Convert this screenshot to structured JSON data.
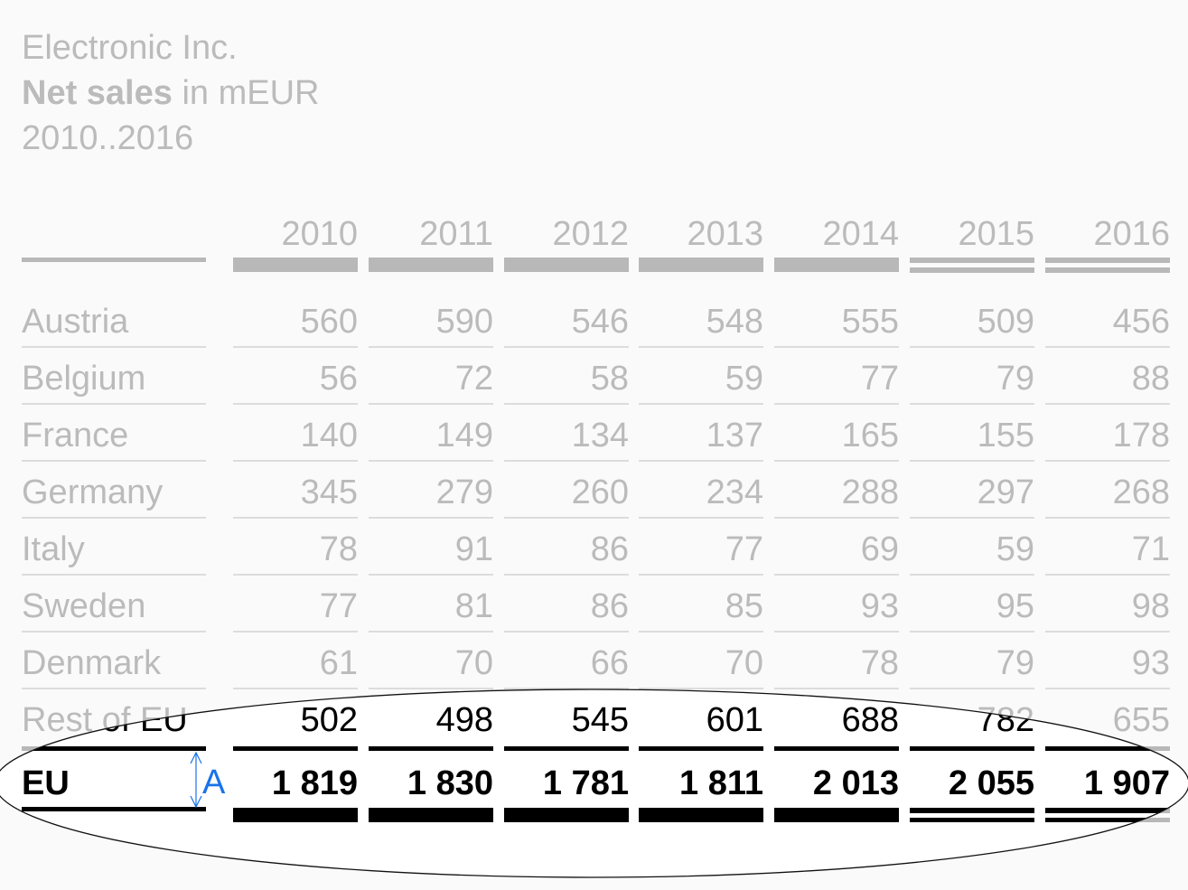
{
  "header": {
    "company": "Electronic Inc.",
    "measure_bold": "Net sales",
    "measure_rest": " in mEUR",
    "period": "2010..2016"
  },
  "colors": {
    "background": "#fafafa",
    "muted_text": "#bbbbbb",
    "muted_rule": "#dcdcdc",
    "muted_bar": "#b8b8b8",
    "highlight_text": "#000000",
    "highlight_bg": "#ffffff",
    "annotation": "#1a73e8"
  },
  "annotation": {
    "label": "A",
    "icon": "vertical-double-arrow-icon"
  },
  "chart_data": {
    "type": "table",
    "title": "Electronic Inc. Net sales in mEUR 2010..2016",
    "unit": "mEUR",
    "columns": [
      "2010",
      "2011",
      "2012",
      "2013",
      "2014",
      "2015",
      "2016"
    ],
    "column_styles": [
      "actual",
      "actual",
      "actual",
      "actual",
      "actual",
      "plan",
      "plan"
    ],
    "rows": [
      {
        "label": "Austria",
        "values": [
          560,
          590,
          546,
          548,
          555,
          509,
          456
        ]
      },
      {
        "label": "Belgium",
        "values": [
          56,
          72,
          58,
          59,
          77,
          79,
          88
        ]
      },
      {
        "label": "France",
        "values": [
          140,
          149,
          134,
          137,
          165,
          155,
          178
        ]
      },
      {
        "label": "Germany",
        "values": [
          345,
          279,
          260,
          234,
          288,
          297,
          268
        ]
      },
      {
        "label": "Italy",
        "values": [
          78,
          91,
          86,
          77,
          69,
          59,
          71
        ]
      },
      {
        "label": "Sweden",
        "values": [
          77,
          81,
          86,
          85,
          93,
          95,
          98
        ]
      },
      {
        "label": "Denmark",
        "values": [
          61,
          70,
          66,
          70,
          78,
          79,
          93
        ]
      },
      {
        "label": "Rest of EU",
        "values": [
          502,
          498,
          545,
          601,
          688,
          782,
          655
        ]
      }
    ],
    "total": {
      "label": "EU",
      "values": [
        1819,
        1830,
        1781,
        1811,
        2013,
        2055,
        1907
      ]
    },
    "highlight": "ellipse around total row"
  }
}
